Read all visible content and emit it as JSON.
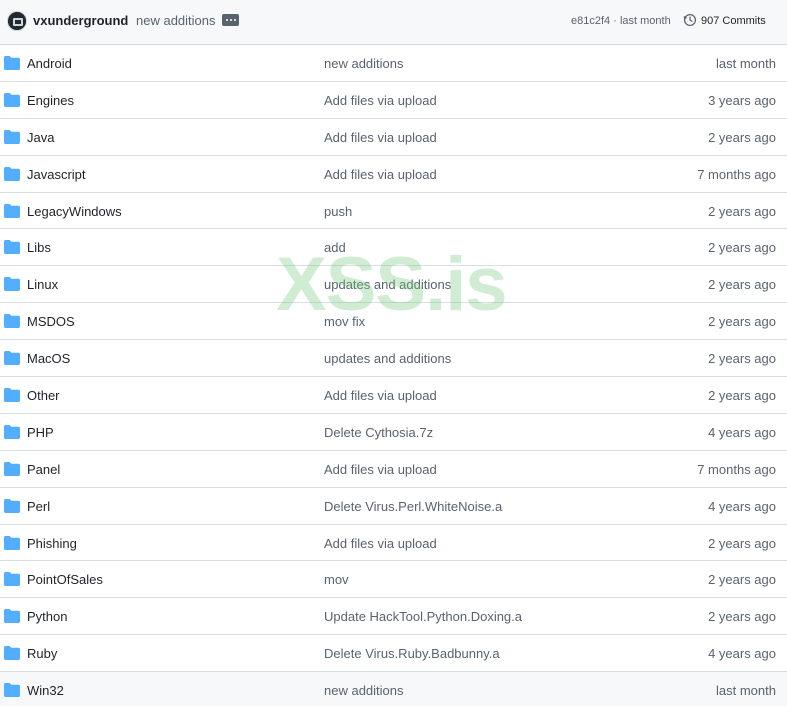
{
  "header": {
    "owner": "vxunderground",
    "commit_message": "new additions",
    "commit_hash": "e81c2f4",
    "commit_time": "last month",
    "commits_label": "907 Commits",
    "icons": {
      "avatar": "avatar",
      "ellipsis": "ellipsis-icon",
      "history": "history-icon"
    }
  },
  "colors": {
    "folder": "#54aeff",
    "header_bg": "#f6f8fa",
    "muted_text": "#59636e",
    "watermark": "#78c882"
  },
  "files": [
    {
      "name": "Android",
      "message": "new additions",
      "age": "last month"
    },
    {
      "name": "Engines",
      "message": "Add files via upload",
      "age": "3 years ago"
    },
    {
      "name": "Java",
      "message": "Add files via upload",
      "age": "2 years ago"
    },
    {
      "name": "Javascript",
      "message": "Add files via upload",
      "age": "7 months ago"
    },
    {
      "name": "LegacyWindows",
      "message": "push",
      "age": "2 years ago"
    },
    {
      "name": "Libs",
      "message": "add",
      "age": "2 years ago"
    },
    {
      "name": "Linux",
      "message": "updates and additions",
      "age": "2 years ago"
    },
    {
      "name": "MSDOS",
      "message": "mov fix",
      "age": "2 years ago"
    },
    {
      "name": "MacOS",
      "message": "updates and additions",
      "age": "2 years ago"
    },
    {
      "name": "Other",
      "message": "Add files via upload",
      "age": "2 years ago"
    },
    {
      "name": "PHP",
      "message": "Delete Cythosia.7z",
      "age": "4 years ago"
    },
    {
      "name": "Panel",
      "message": "Add files via upload",
      "age": "7 months ago"
    },
    {
      "name": "Perl",
      "message": "Delete Virus.Perl.WhiteNoise.a",
      "age": "4 years ago"
    },
    {
      "name": "Phishing",
      "message": "Add files via upload",
      "age": "2 years ago"
    },
    {
      "name": "PointOfSales",
      "message": "mov",
      "age": "2 years ago"
    },
    {
      "name": "Python",
      "message": "Update HackTool.Python.Doxing.a",
      "age": "2 years ago"
    },
    {
      "name": "Ruby",
      "message": "Delete Virus.Ruby.Badbunny.a",
      "age": "4 years ago"
    },
    {
      "name": "Win32",
      "message": "new additions",
      "age": "last month"
    }
  ],
  "watermark": "XSS.is"
}
